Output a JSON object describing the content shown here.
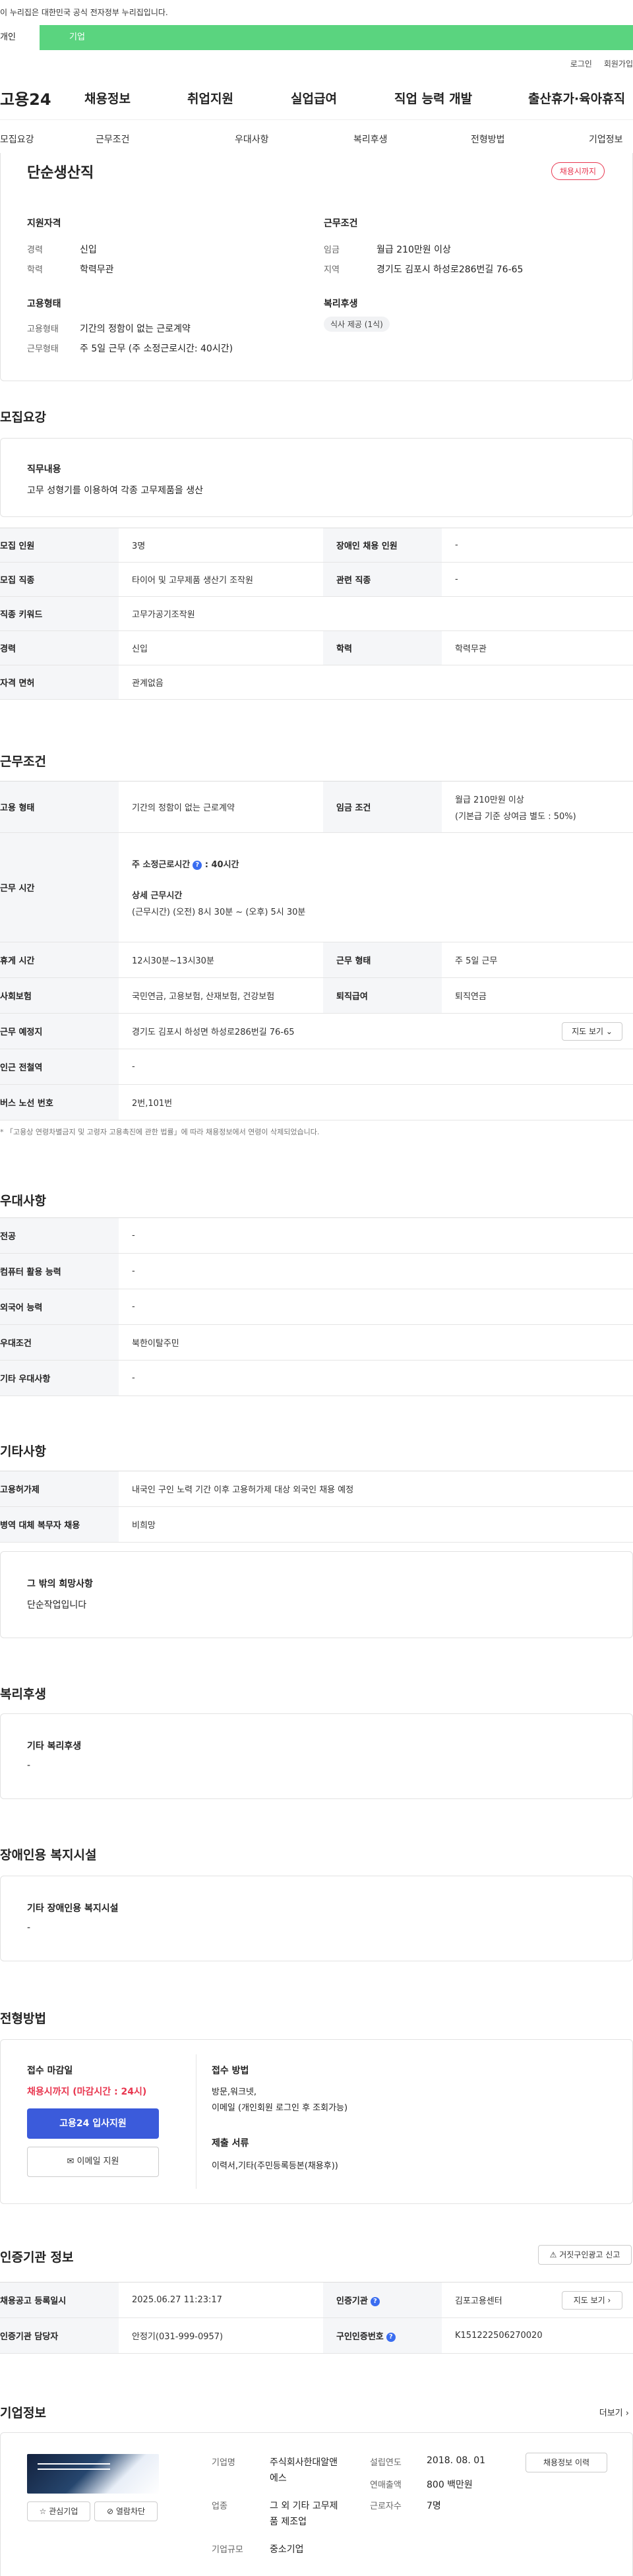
{
  "notice": "이 누리집은 대한민국 공식 전자정부 누리집입니다.",
  "tabs": {
    "personal": "개인",
    "company": "기업"
  },
  "util": {
    "login": "로그인",
    "join": "회원가입"
  },
  "gnb": {
    "logo": "고용24",
    "menu": [
      "채용정보",
      "취업지원",
      "실업급여",
      "직업 능력 개발",
      "출산휴가·육아휴직"
    ]
  },
  "subnav": [
    "모집요강",
    "근무조건",
    "우대사항",
    "복리후생",
    "전형방법",
    "기업정보"
  ],
  "summary": {
    "title": "단순생산직",
    "badge": "채용시까지",
    "req_heading": "지원자격",
    "career_label": "경력",
    "career_value": "신입",
    "edu_label": "학력",
    "edu_value": "학력무관",
    "cond_heading": "근무조건",
    "wage_label": "임금",
    "wage_value": "월급 210만원 이상",
    "area_label": "지역",
    "area_value": "경기도 김포시 하성로286번길 76-65",
    "emp_heading": "고용형태",
    "emp_type_label": "고용형태",
    "emp_type_value": "기간의 정함이 없는 근로계약",
    "work_type_label": "근무형태",
    "work_type_value": "주 5일 근무 (주 소정근로시간: 40시간)",
    "welfare_heading": "복리후생",
    "welfare_tag": "식사 제공 (1식)"
  },
  "recruit": {
    "heading": "모집요강",
    "duty_label": "직무내용",
    "duty_value": "고무 성형기를 이용하여 각종 고무제품을 생산",
    "rows": [
      {
        "l1": "모집 인원",
        "v1": "3명",
        "l2": "장애인 채용 인원",
        "v2": "-"
      },
      {
        "l1": "모집 직종",
        "v1": "타이어 및 고무제품 생산기 조작원",
        "l2": "관련 직종",
        "v2": "-"
      },
      {
        "l1": "직종 키워드",
        "v1": "고무가공기조작원"
      },
      {
        "l1": "경력",
        "v1": "신입",
        "l2": "학력",
        "v2": "학력무관"
      },
      {
        "l1": "자격 면허",
        "v1": "관계없음"
      }
    ]
  },
  "conditions": {
    "heading": "근무조건",
    "emp_label": "고용 형태",
    "emp_value": "기간의 정함이 없는 근로계약",
    "wage_label": "임금 조건",
    "wage_value": "월급 210만원 이상",
    "wage_note": "(기본급 기준 상여금 별도 : 50%)",
    "hours_label": "근무 시간",
    "hours_main": "주 소정근로시간",
    "hours_main_value": ": 40시간",
    "hours_detail_label": "상세 근무시간",
    "hours_detail": "(근무시간) (오전) 8시 30분 ~ (오후) 5시 30분",
    "rest_label": "휴게 시간",
    "rest_value": "12시30분~13시30분",
    "worktype_label": "근무 형태",
    "worktype_value": "주 5일 근무",
    "insurance_label": "사회보험",
    "insurance_value": "국민연금, 고용보험, 산재보험, 건강보험",
    "retire_label": "퇴직급여",
    "retire_value": "퇴직연금",
    "place_label": "근무 예정지",
    "place_value": "경기도 김포시 하성면 하성로286번길 76-65",
    "map_button": "지도 보기",
    "station_label": "인근 전철역",
    "station_value": "-",
    "bus_label": "버스 노선 번호",
    "bus_value": "2번,101번",
    "footnote": "* 「고용상 연령차별금지 및 고령자 고용촉진에 관한 법률」에 따라 채용정보에서 연령이 삭제되었습니다."
  },
  "preference": {
    "heading": "우대사항",
    "rows": [
      {
        "label": "전공",
        "value": "-"
      },
      {
        "label": "컴퓨터 활용 능력",
        "value": "-"
      },
      {
        "label": "외국어 능력",
        "value": "-"
      },
      {
        "label": "우대조건",
        "value": "북한이탈주민"
      },
      {
        "label": "기타 우대사항",
        "value": "-"
      }
    ]
  },
  "others": {
    "heading": "기타사항",
    "rows": [
      {
        "label": "고용허가제",
        "value": "내국인 구인 노력 기간 이후 고용허가제 대상 외국인 채용 예정"
      },
      {
        "label": "병역 대체 복무자 채용",
        "value": "비희망"
      }
    ],
    "etc_label": "그 밖의 희망사항",
    "etc_value": "단순작업입니다"
  },
  "welfare": {
    "heading": "복리후생",
    "label": "기타 복리후생",
    "value": "-"
  },
  "disabled": {
    "heading": "장애인용 복지시설",
    "label": "기타 장애인용 복지시설",
    "value": "-"
  },
  "selection": {
    "heading": "전형방법",
    "deadline_label": "접수 마감일",
    "deadline_value": "채용시까지 (마감시간 : 24시)",
    "apply_button": "고용24 입사지원",
    "email_button": "이메일 지원",
    "method_label": "접수 방법",
    "method_value_1": "방문,워크넷,",
    "method_value_2": "이메일 (개인회원 로그인 후 조회가능)",
    "docs_label": "제출 서류",
    "docs_value": "이력서,기타(주민등록등본(채용후))"
  },
  "agency": {
    "heading": "인증기관 정보",
    "report_button": "거짓구인광고 신고",
    "reg_label": "채용공고 등록일시",
    "reg_value": "2025.06.27 11:23:17",
    "auth_label": "인증기관",
    "auth_value": "김포고용센터",
    "map_button": "지도 보기",
    "manager_label": "인증기관 담당자",
    "manager_value": "안정기(031-999-0957)",
    "auth_no_label": "구인인증번호",
    "auth_no_value": "K151222506270020"
  },
  "company": {
    "heading": "기업정보",
    "more": "더보기",
    "interest_button": "관심기업",
    "block_button": "열람차단",
    "name_label": "기업명",
    "name_value_1": "주식회사한대알앤",
    "name_value_2": "에스",
    "biz_label": "업종",
    "biz_value_1": "그 외 기타 고무제",
    "biz_value_2": "품 제조업",
    "size_label": "기업규모",
    "size_value": "중소기업",
    "founded_label": "설립연도",
    "founded_value": "2018. 08. 01",
    "sales_label": "연매출액",
    "sales_value": "800 백만원",
    "staff_label": "근로자수",
    "staff_value": "7명",
    "history_button": "채용정보 이력"
  },
  "colors": {
    "accent": "#5ad47f",
    "primary_button": "#3b5bdb",
    "alert": "#e8364f"
  }
}
